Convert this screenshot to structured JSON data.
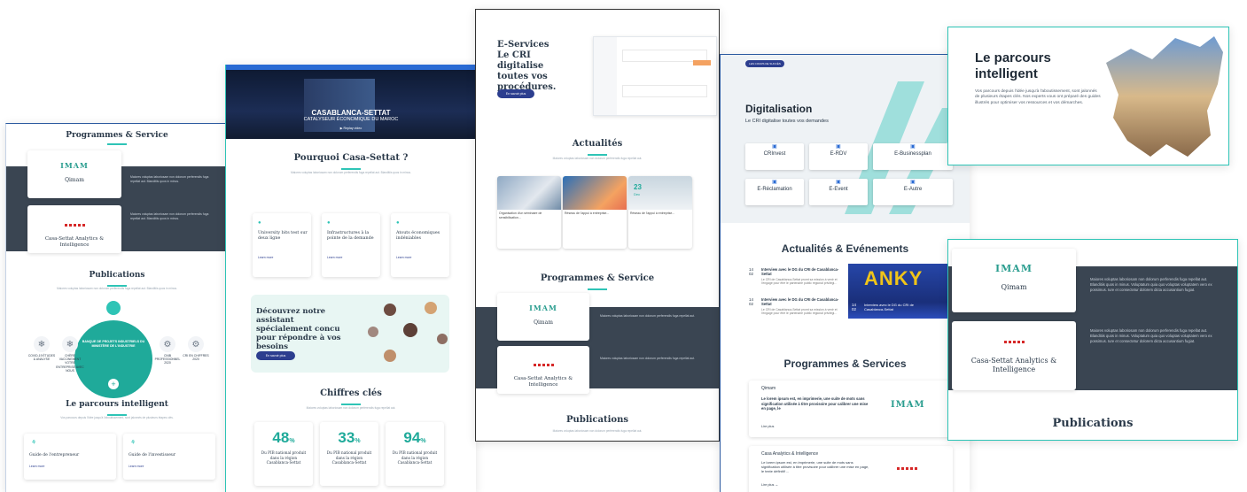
{
  "colors": {
    "teal": "#2ec4b6",
    "navy": "#2c3e8f",
    "dark_band": "#3a4552"
  },
  "panel1": {
    "title": "Programmes & Service",
    "programmes": [
      {
        "name": "Qimam",
        "logo": "IMAM"
      },
      {
        "name": "Casa-Settat Analytics & Intelligence"
      }
    ],
    "publications_title": "Publications",
    "hub_title": "BANQUE DE PROJETS INDUSTRIELS DU MINISTÈRE DE L'INDUSTRIE",
    "hub_items": [
      "COVID-19 ÉTUDES & ANALYSE",
      "CHÈRE VACCINEMENT VOTRE ENTREPRISE AVEC NOUS",
      "CNIB PROFESSIONNEL 2020",
      "CRI EN CHIFFRES 2020"
    ],
    "parcours_title": "Le parcours intelligent",
    "guides": [
      {
        "label": "Guide de l'entrepreneur",
        "link": "Learn more"
      },
      {
        "label": "Guide de l'investisseur",
        "link": "Learn more"
      }
    ]
  },
  "panel2": {
    "hero_line1": "CASABLANCA-SETTAT",
    "hero_line2": "CATALYSEUR ÉCONOMIQUE DU MAROC",
    "hero_video": "Replay video",
    "why_title": "Pourquoi Casa-Settat ?",
    "features": [
      {
        "title": "University bits test sur deux ligne",
        "link": "Learn more"
      },
      {
        "title": "Infrastructures à la pointe de la demande",
        "link": "Learn more"
      },
      {
        "title": "Atouts économiques indéniables",
        "link": "Learn more"
      }
    ],
    "assistant_title": "Découvrez notre assistant spécialement concu pour répondre à vos besoins",
    "assistant_button": "En savoir plus",
    "figures_title": "Chiffres clés",
    "stats": [
      {
        "value": "48",
        "unit": "%",
        "label": "Du PIB national produit dans la région Casablanca-Settat"
      },
      {
        "value": "33",
        "unit": "%",
        "label": "Du PIB national produit dans la région Casablanca-Settat"
      },
      {
        "value": "94",
        "unit": "%",
        "label": "Du PIB national produit dans la région Casablanca-Settat"
      }
    ]
  },
  "panel3": {
    "hero_title_1": "E-Services",
    "hero_title_2": "Le CRI digitalise toutes vos procédures.",
    "hero_button": "En savoir plus",
    "news_title": "Actualités",
    "programmes_title": "Programmes & Service",
    "programmes": [
      {
        "name": "Qimam",
        "logo": "IMAM"
      },
      {
        "name": "Casa-Settat Analytics & Intelligence"
      }
    ],
    "publications_title": "Publications",
    "news_date_day": "23",
    "news_date_month": "Dec"
  },
  "panel4": {
    "title": "Digitalisation",
    "subtitle": "Le CRI digitalise toutes vos demandes",
    "services": [
      "CRInvest",
      "E-RDV",
      "E-Businessplan",
      "E-Réclamation",
      "E-Event",
      "E-Autre"
    ],
    "events_title": "Actualités & Evénements",
    "events": [
      {
        "day": "14",
        "month": "02",
        "title": "Interview avec le DG du CRI de Casablanca-Settat",
        "text": "Le CRI de Casablanca-Settat promt sa mission à venir et l'engage pour être le partenaire public régional privilégi..."
      },
      {
        "day": "14",
        "month": "02",
        "title": "Interview avec le DG du CRI de Casablanca-Settat",
        "text": "Le CRI de Casablanca-Settat promt sa mission à venir et l'engage pour être le partenaire public régional privilégi..."
      }
    ],
    "featured_event": {
      "day": "14",
      "month": "02",
      "title": "Interview avec le DG du CRI de Casablanca-Settat"
    },
    "programmes_title": "Programmes & Services",
    "programmes": [
      {
        "name": "Qimam",
        "logo": "IMAM",
        "text": "Le lorem ipsum est, en imprimerie, une suite de mots sans signification utilisée à titre provisoire pour calibrer une mise en page, le",
        "link": "Lire plus"
      },
      {
        "name": "Casa Analytics & Intelligence",
        "text": "Le lorem ipsum est, en imprimerie, une suite de mots sans signification utilisée à titre provisoire pour calibrer une mise en page, le texte définitif ...",
        "link": "Lire plus →"
      }
    ]
  },
  "panel5": {
    "title": "Le parcours intelligent",
    "text": "Vos parcours depuis l'idée jusqu'à l'aboutissement, sont jalonnés de plusieurs étapes clés. Nos experts vous ont préparé des guides illustrés pour optimiser vos ressources et vos démarches."
  },
  "panel6": {
    "programmes": [
      {
        "name": "Qimam",
        "logo": "IMAM",
        "text": "Maiores voluptas laboriosam non dolorum perferendis fuga repellat aut. Blanditiis quos in minus. Voluptatum quia quo voluptas voluptatem vero ex possimus. Iure et consectetur dolorem dicta accusantium fugiat."
      },
      {
        "name": "Casa-Settat Analytics & Intelligence",
        "text": "Maiores voluptas laboriosam non dolorum perferendis fuga repellat aut. Blanditiis quos in minus. Voluptatum quia quo voluptas voluptatem vero ex possimus. Iure et consectetur dolorem dicta accusantium fugiat."
      }
    ],
    "publications_title": "Publications"
  }
}
